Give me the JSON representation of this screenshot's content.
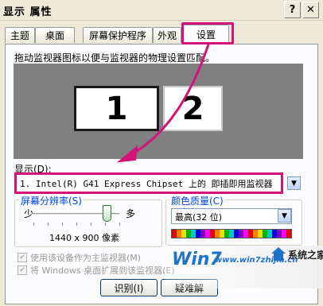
{
  "window": {
    "title": "显示 属性",
    "help_label": "?",
    "close_label": "✕"
  },
  "tabs": [
    {
      "label": "主题"
    },
    {
      "label": "桌面"
    },
    {
      "label": "屏幕保护程序"
    },
    {
      "label": "外观"
    },
    {
      "label": "设置"
    }
  ],
  "settings": {
    "instruction": "拖动监视器图标以便与监视器的物理设置匹配。",
    "monitors": [
      {
        "label": "1"
      },
      {
        "label": "2"
      }
    ],
    "display_label": "显示(D):",
    "display_value": "1. Intel(R) G41 Express Chipset 上的 即插即用监视器",
    "resolution": {
      "title": "屏幕分辨率(S)",
      "less_label": "少",
      "more_label": "多",
      "value": "1440 x 900 像素",
      "slider_fraction": 0.9
    },
    "color_quality": {
      "title": "颜色质量(C)",
      "value": "最高(32 位)"
    },
    "checkboxes": [
      {
        "label": "使用该设备作为主监视器(M)",
        "checked": true,
        "enabled": false
      },
      {
        "label": "将 Windows 桌面扩展到该监视器(E)",
        "checked": true,
        "enabled": false
      }
    ],
    "buttons": {
      "identify": "识别(I)",
      "troubleshoot": "疑难解"
    }
  },
  "watermark": {
    "brand": "Win7",
    "site_text": "www.win7zhijia.cn",
    "name": "系统之家"
  },
  "colors": {
    "highlight": "#d3137a",
    "dialog_bg": "#ECE9D8",
    "monitor_area": "#808080"
  }
}
